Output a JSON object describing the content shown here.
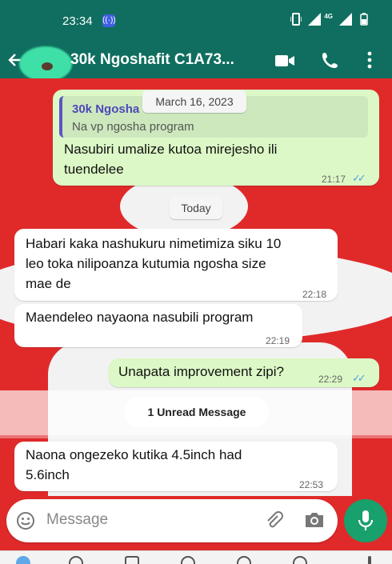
{
  "status_bar": {
    "time": "23:34",
    "network": "4G"
  },
  "header": {
    "contact_name": "30k Ngoshafit C1A73..."
  },
  "messages": {
    "m1": {
      "quote_name": "30k Ngosha",
      "quote_text": "Na vp ngosha program",
      "text_line1": "Nasubiri umalize kutoa mirejesho ili",
      "text_line2": "tuendelee",
      "time": "21:17",
      "ticks": "✓✓"
    },
    "date_chip_1": "March 16, 2023",
    "date_chip_2": "Today",
    "m2": {
      "text_line1": "Habari kaka nashukuru nimetimiza siku 10",
      "text_line2": "leo toka nilipoanza kutumia ngosha size",
      "text_line3": "mae de",
      "time": "22:18"
    },
    "m3": {
      "text": "Maendeleo nayaona  nasubili program",
      "time": "22:19"
    },
    "m4": {
      "text": "Unapata improvement zipi?",
      "time": "22:29",
      "ticks": "✓✓"
    },
    "unread": "1 Unread Message",
    "m5": {
      "text_line1": "Naona ongezeko kutika 4.5inch had",
      "text_line2": "5.6inch",
      "time": "22:53"
    }
  },
  "composer": {
    "placeholder": "Message"
  },
  "colors": {
    "header": "#0f6e5f",
    "outgoing": "#dcf8c6",
    "incoming": "#ffffff",
    "mic": "#18a06d"
  }
}
